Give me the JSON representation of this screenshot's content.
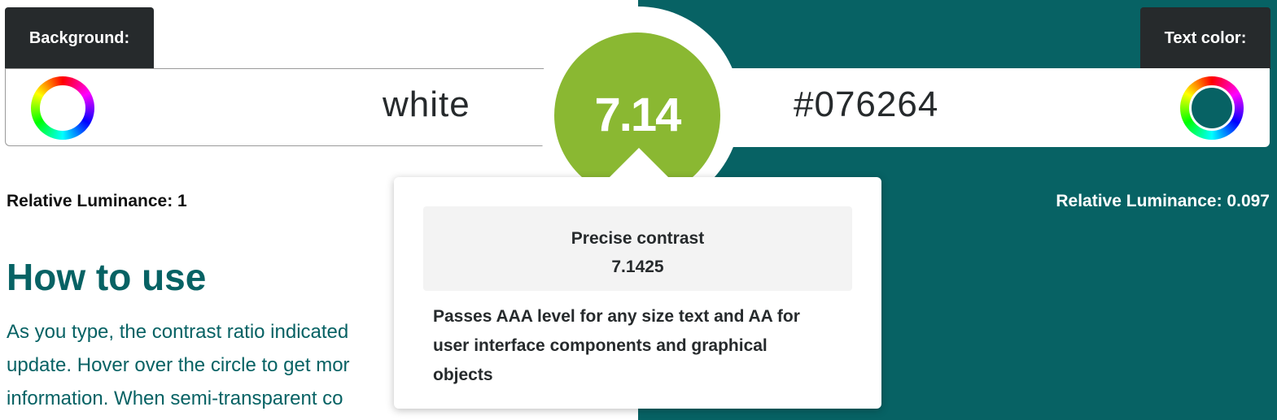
{
  "background": {
    "tab_label": "Background:",
    "value": "white",
    "relative_luminance": "Relative Luminance: 1",
    "color": "#ffffff"
  },
  "text_color": {
    "tab_label": "Text color:",
    "value": "#076264",
    "relative_luminance": "Relative Luminance: 0.097",
    "color": "#076264"
  },
  "contrast": {
    "ratio": "7.14",
    "circle_color": "#8ab832"
  },
  "tooltip": {
    "precise_label": "Precise contrast",
    "precise_value": "7.1425",
    "verdict_lines": [
      "Passes AAA level for any size text and AA for",
      "user interface components and graphical",
      "objects"
    ]
  },
  "how_to_use": {
    "title": "How to use",
    "lines": [
      "As you type, the contrast ratio indicated",
      "update. Hover over the circle to get mor",
      "information. When semi-transparent co"
    ]
  },
  "icons": {
    "background_picker": "color-wheel-icon",
    "text_picker": "color-wheel-icon"
  }
}
